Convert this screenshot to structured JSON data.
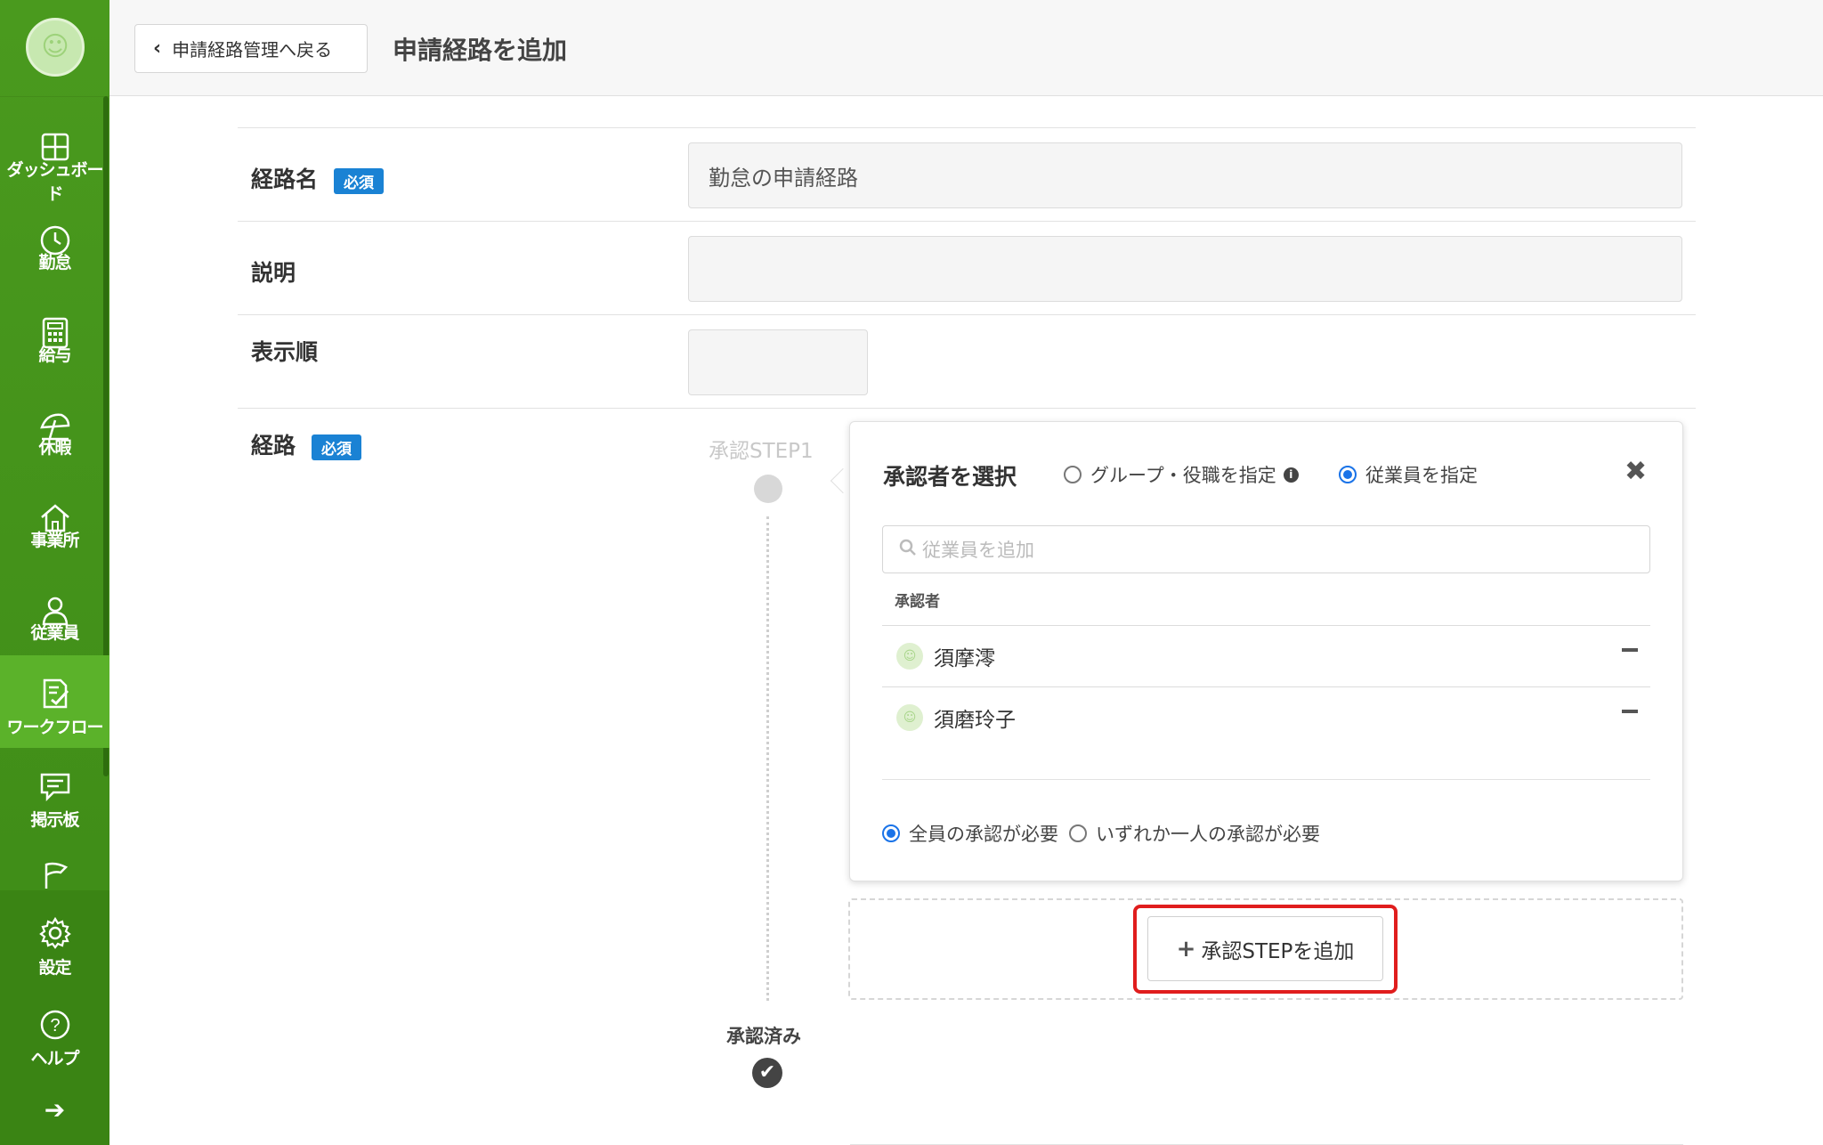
{
  "header": {
    "back_label": "申請経路管理へ戻る",
    "title": "申請経路を追加"
  },
  "sidebar": {
    "items": [
      {
        "label": "ダッシュボード",
        "icon": "dashboard-icon"
      },
      {
        "label": "勤怠",
        "icon": "clock-icon"
      },
      {
        "label": "給与",
        "icon": "calculator-icon"
      },
      {
        "label": "休暇",
        "icon": "umbrella-icon"
      },
      {
        "label": "事業所",
        "icon": "home-icon"
      },
      {
        "label": "従業員",
        "icon": "person-icon"
      },
      {
        "label": "ワークフロー",
        "icon": "checklist-icon"
      },
      {
        "label": "掲示板",
        "icon": "message-icon"
      },
      {
        "label": "",
        "icon": "flag-icon"
      },
      {
        "label": "設定",
        "icon": "gear-icon"
      },
      {
        "label": "ヘルプ",
        "icon": "help-icon"
      }
    ],
    "active": "ワークフロー",
    "collapse_glyph": "➔"
  },
  "form": {
    "route_name_label": "経路名",
    "required_badge": "必須",
    "route_name_value": "勤怠の申請経路",
    "description_label": "説明",
    "description_value": "",
    "order_label": "表示順",
    "order_value": "",
    "route_label": "経路"
  },
  "route": {
    "step_label": "承認STEP1",
    "done_label": "承認済み",
    "done_glyph": "✔"
  },
  "popover": {
    "title": "承認者を選択",
    "option_group": "グループ・役職を指定",
    "option_employee": "従業員を指定",
    "selected_option": "従業員を指定",
    "info_glyph": "i",
    "close_glyph": "✖",
    "search_placeholder": "従業員を追加",
    "approver_header": "承認者",
    "approvers": [
      {
        "name": "須摩澪"
      },
      {
        "name": "須磨玲子"
      }
    ],
    "condition_all": "全員の承認が必要",
    "condition_any": "いずれか一人の承認が必要",
    "selected_condition": "全員の承認が必要"
  },
  "add_step": {
    "label": "承認STEPを追加",
    "plus": "+"
  },
  "colors": {
    "sidebar_green": "#4a9a1e",
    "active_green": "#5bb22a",
    "badge_blue": "#1a82d4",
    "radio_blue": "#1a73e8",
    "highlight_red": "#e01d1d"
  }
}
